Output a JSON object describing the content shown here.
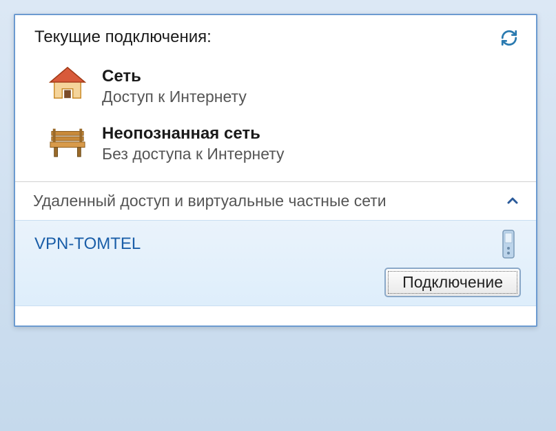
{
  "header": {
    "title": "Текущие подключения:"
  },
  "connections": [
    {
      "icon": "house-icon",
      "name": "Сеть",
      "status": "Доступ к Интернету"
    },
    {
      "icon": "bench-icon",
      "name": "Неопознанная сеть",
      "status": "Без доступа к Интернету"
    }
  ],
  "section": {
    "title": "Удаленный доступ и виртуальные частные сети"
  },
  "vpn": {
    "name": "VPN-TOMTEL",
    "connect_label": "Подключение"
  }
}
